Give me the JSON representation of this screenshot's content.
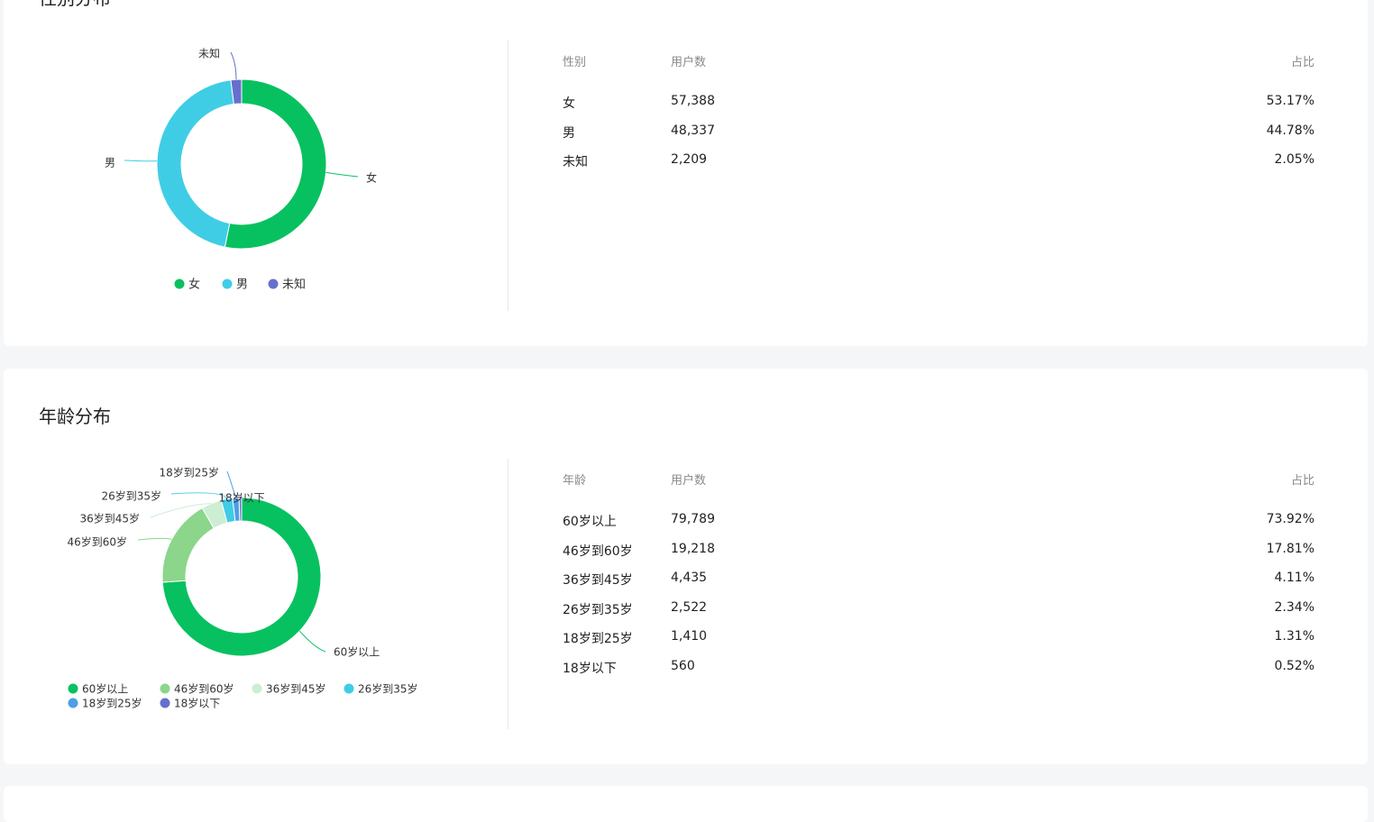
{
  "gender": {
    "title": "性别分布",
    "table_headers": [
      "性别",
      "用户数",
      "占比"
    ],
    "rows": [
      {
        "label": "女",
        "count": "57,388",
        "pct": "53.17%"
      },
      {
        "label": "男",
        "count": "48,337",
        "pct": "44.78%"
      },
      {
        "label": "未知",
        "count": "2,209",
        "pct": "2.05%"
      }
    ]
  },
  "age": {
    "title": "年龄分布",
    "table_headers": [
      "年龄",
      "用户数",
      "占比"
    ],
    "rows": [
      {
        "label": "60岁以上",
        "count": "79,789",
        "pct": "73.92%"
      },
      {
        "label": "46岁到60岁",
        "count": "19,218",
        "pct": "17.81%"
      },
      {
        "label": "36岁到45岁",
        "count": "4,435",
        "pct": "4.11%"
      },
      {
        "label": "26岁到35岁",
        "count": "2,522",
        "pct": "2.34%"
      },
      {
        "label": "18岁到25岁",
        "count": "1,410",
        "pct": "1.31%"
      },
      {
        "label": "18岁以下",
        "count": "560",
        "pct": "0.52%"
      }
    ]
  },
  "chart_data": [
    {
      "type": "pie",
      "title": "性别分布",
      "categories": [
        "女",
        "男",
        "未知"
      ],
      "values": [
        57388,
        48337,
        2209
      ],
      "colors": [
        "#07c160",
        "#3fcde6",
        "#6670cc"
      ],
      "legend": "bottom"
    },
    {
      "type": "pie",
      "title": "年龄分布",
      "categories": [
        "60岁以上",
        "46岁到60岁",
        "36岁到45岁",
        "26岁到35岁",
        "18岁到25岁",
        "18岁以下"
      ],
      "values": [
        79789,
        19218,
        4435,
        2522,
        1410,
        560
      ],
      "colors": [
        "#07c160",
        "#8bd68a",
        "#cdeed3",
        "#3fcde6",
        "#4e9fe6",
        "#6670cc"
      ],
      "legend": "bottom"
    }
  ]
}
